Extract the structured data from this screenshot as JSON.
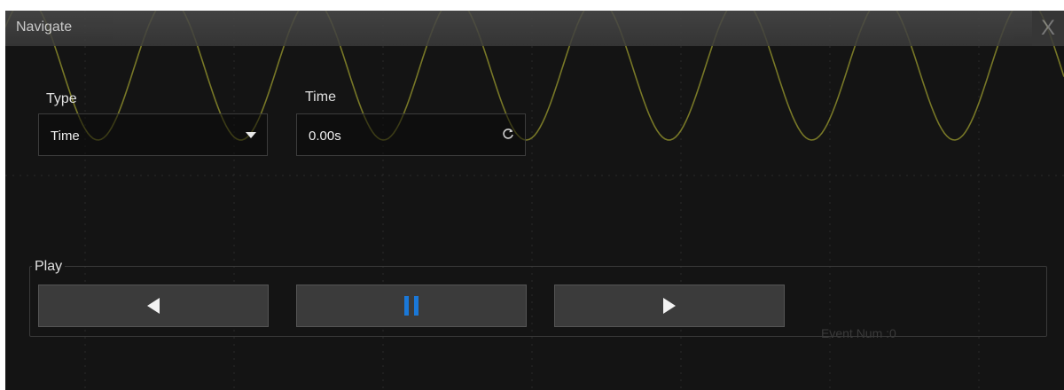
{
  "dialog": {
    "title": "Navigate",
    "close_label": "X"
  },
  "type_field": {
    "label": "Type",
    "value": "Time"
  },
  "time_field": {
    "label": "Time",
    "value": "0.00s"
  },
  "play": {
    "label": "Play",
    "buttons": [
      {
        "name": "play-backward",
        "icon": "triangle-left-icon"
      },
      {
        "name": "pause",
        "icon": "pause-icon"
      },
      {
        "name": "play-forward",
        "icon": "triangle-right-icon"
      }
    ]
  },
  "event_num": "Event Num :0",
  "colors": {
    "background": "#141414",
    "waveform": "#8a8a2a",
    "pause_icon": "#1a78d8",
    "button": "#3b3b3b"
  }
}
